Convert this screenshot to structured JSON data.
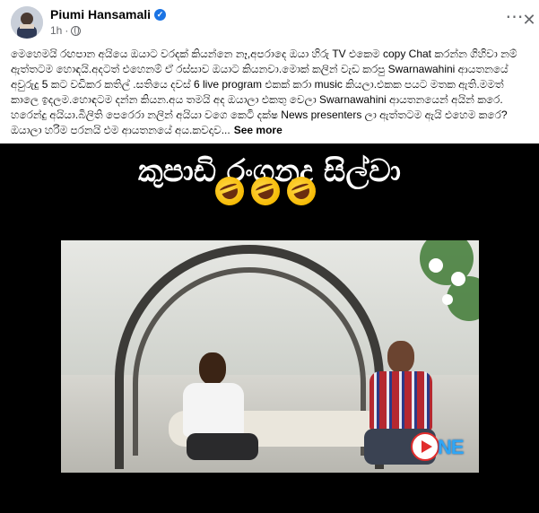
{
  "post": {
    "author_name": "Piumi Hansamali",
    "time": "1h",
    "body_text": "මෙහෙමයි රඟපාන අයියෙ ඔයාට වරදක් කියන්නෙ නෑ,අපරාදෙ ඔයා හිරු TV එකෙම copy Chat කරන්න ගිහිවා නම් ඇත්තටම හොඳයි.අදටත් එහෙනම් ඒ රස්සාව ඔයාට කියනවා.මොක් කලින් වැඩ කරපු Swarnawahini ආයතනයේ අවුරුදු 5 කට වඩිකර කතිල් .සතියෙ දවස් 6 live program එකක් කරා music කියලා.එකක පයට මතක ඇති.මමත් කාලෙ ඉදලම.හොඳටම දන්න කියන.අය තමයි අද ඔයාලා එකතු වෙලා Swarnawahini ආයතනයෙන් අයින් කරෙ. හරෙන්දු අයියා.බිලිති පෙරෙරා නලින් අයියා වගෙ කෙටි දක්ෂ News presenters ලා ඇත්තටම ඇයි එහෙම කරෙ?ඔයාලා හරිම පරනයි එම ආයතනයේ අය.කවදාව...",
    "see_more": "See more"
  },
  "video": {
    "title": "කුපාඩි රංගනද සිල්වා",
    "emoji": [
      "rolling-on-floor-laughing-icon",
      "rolling-on-floor-laughing-icon",
      "rolling-on-floor-laughing-icon"
    ],
    "logo_text": "NE"
  },
  "icons": {
    "more": "⋯",
    "close": "✕",
    "verified": "✓"
  },
  "colors": {
    "accent": "#1b74e4",
    "media_background": "#000000",
    "logo_red": "#e12c2c",
    "logo_blue": "#2fa6f5"
  }
}
